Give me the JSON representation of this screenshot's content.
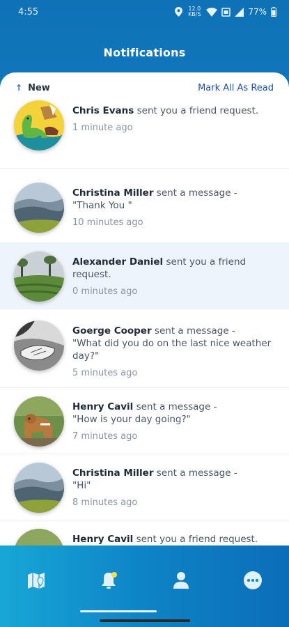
{
  "status_bar": {
    "time": "4:55",
    "data_rate": "12.0 KB/S",
    "battery": "77%"
  },
  "header": {
    "title": "Notifications"
  },
  "section": {
    "new_label": "New",
    "mark_all": "Mark All As Read"
  },
  "notifications": [
    {
      "name": "Chris Evans",
      "action": "sent you a friend request.",
      "message": "",
      "time": "1 minute ago",
      "avatar": "dinosaur-cartoon"
    },
    {
      "name": "Christina Miller",
      "action": "sent a message -",
      "message": "\"Thank You \"",
      "time": "10 minutes ago",
      "avatar": "mountain-landscape"
    },
    {
      "name": "Alexander Daniel",
      "action": "sent you a friend request.",
      "message": "",
      "time": "0 minutes ago",
      "avatar": "tea-plantation"
    },
    {
      "name": "Goerge Cooper",
      "action": "sent a message -",
      "message": "\"What did you do on the last nice weather day?\"",
      "time": "5 minutes ago",
      "avatar": "holding-hands-bw"
    },
    {
      "name": "Henry Cavil",
      "action": "sent a message -",
      "message": "\"How is your day going?\"",
      "time": "7 minutes ago",
      "avatar": "dog-photo"
    },
    {
      "name": "Christina Miller",
      "action": "sent a message -",
      "message": "\"Hi\"",
      "time": "8 minutes ago",
      "avatar": "mountain-landscape"
    },
    {
      "name": "Henry Cavil",
      "action": "sent you a friend request.",
      "message": "",
      "time": "",
      "avatar": "dog-photo"
    }
  ],
  "bottom_nav": [
    {
      "icon": "map-icon"
    },
    {
      "icon": "bell-icon",
      "badge_color": "#f5e04a"
    },
    {
      "icon": "user-icon"
    },
    {
      "icon": "more-icon"
    }
  ]
}
